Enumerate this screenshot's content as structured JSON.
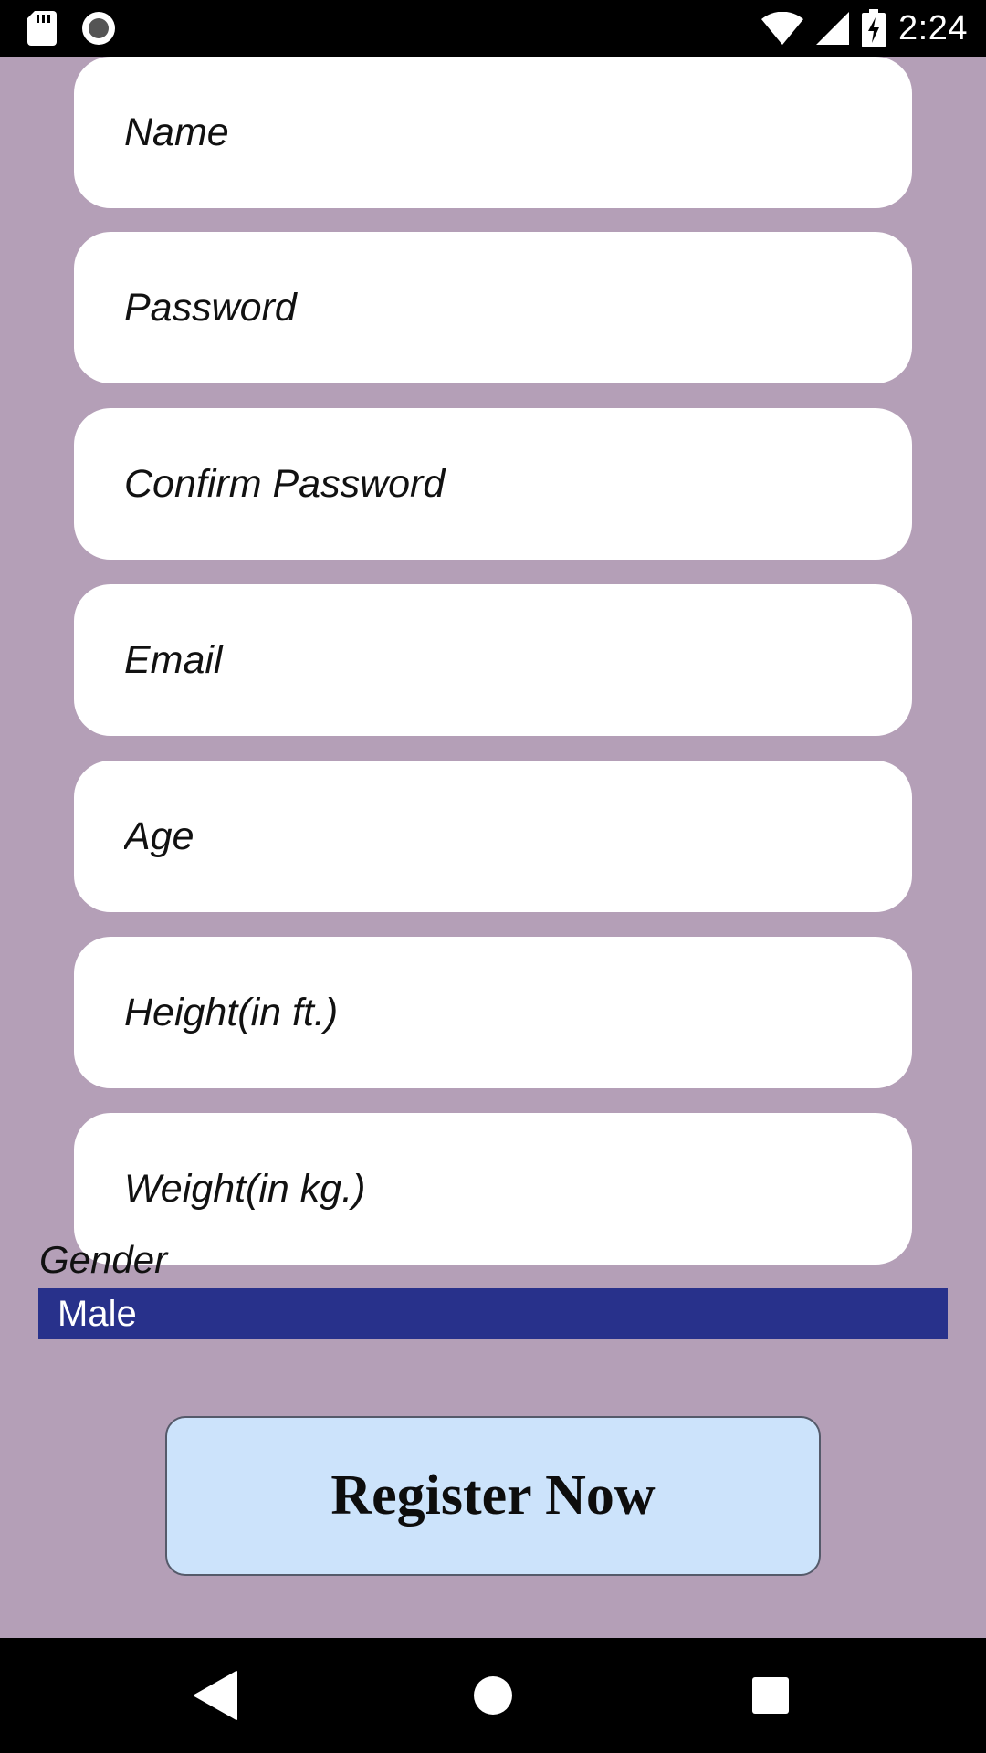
{
  "status_bar": {
    "time": "2:24",
    "icons": [
      "sd-card-icon",
      "record-icon",
      "wifi-icon",
      "signal-icon",
      "battery-charging-icon"
    ]
  },
  "form": {
    "fields": [
      {
        "name": "name",
        "placeholder": "Name",
        "value": ""
      },
      {
        "name": "password",
        "placeholder": "Password",
        "value": ""
      },
      {
        "name": "confirm-password",
        "placeholder": "Confirm Password",
        "value": ""
      },
      {
        "name": "email",
        "placeholder": "Email",
        "value": ""
      },
      {
        "name": "age",
        "placeholder": "Age",
        "value": ""
      },
      {
        "name": "height",
        "placeholder": "Height(in ft.)",
        "value": ""
      },
      {
        "name": "weight",
        "placeholder": "Weight(in kg.)",
        "value": ""
      }
    ],
    "gender_label": "Gender",
    "gender_selected": "Male",
    "submit_label": "Register Now"
  },
  "nav_bar": {
    "icons": [
      "back-icon",
      "home-icon",
      "recents-icon"
    ]
  },
  "colors": {
    "background": "#b49fb7",
    "field_background": "#ffffff",
    "select_background": "#28318b",
    "button_background": "#cce3fb",
    "system_bars": "#000000"
  }
}
